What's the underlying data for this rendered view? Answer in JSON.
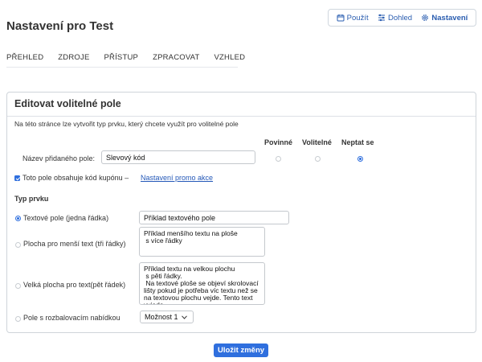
{
  "header": {
    "title": "Nastavení pro Test"
  },
  "top_nav": [
    {
      "label": "Použít",
      "icon": "calendar-icon",
      "active": false
    },
    {
      "label": "Dohled",
      "icon": "sliders-icon",
      "active": false
    },
    {
      "label": "Nastavení",
      "icon": "gear-icon",
      "active": true
    }
  ],
  "tabs": [
    "PŘEHLED",
    "ZDROJE",
    "PŘÍSTUP",
    "ZPRACOVAT",
    "VZHLED"
  ],
  "card": {
    "title": "Editovat volitelné pole",
    "description": "Na této stránce lze vytvořit typ prvku, který chcete využít pro volitelné pole",
    "columns": [
      "Povinné",
      "Volitelné",
      "Neptat se"
    ],
    "selected_column": "Neptat se",
    "field_name_label": "Název přidaného pole:",
    "field_name_value": "Slevový kód",
    "coupon_checkbox_label": "Toto pole obsahuje kód kupónu –",
    "coupon_checked": true,
    "promo_link": "Nastavení promo akce",
    "element_type_title": "Typ prvku",
    "options": {
      "text_line": {
        "label": "Textové pole (jedna řádka)",
        "value": "Příklad textového pole",
        "selected": true
      },
      "small_area": {
        "label": "Plocha pro menší text (tři řádky)",
        "value": "Příklad menšího textu na ploše\n s více řádky",
        "selected": false
      },
      "large_area": {
        "label": "Velká plocha pro text(pět řádek)",
        "value": "Příklad textu na velkou plochu\n s pěti řádky.\n Na textové ploše se objeví skrolovací lišty pokud je potřeba víc textu než se na textovou plochu vejde. Tento text vyjede",
        "selected": false
      },
      "dropdown": {
        "label": "Pole s rozbalovacím nabídkou",
        "value": "Možnost 1",
        "selected": false
      }
    }
  },
  "save_label": "Uložit změny",
  "colors": {
    "accent": "#2f6fde",
    "link": "#2458b8"
  }
}
